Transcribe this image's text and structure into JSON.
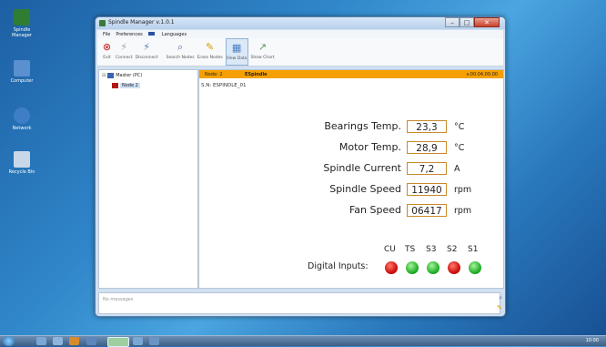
{
  "window": {
    "title": "Spindle Manager v.1.0.1"
  },
  "menu": [
    "File",
    "Preferences",
    "Languages"
  ],
  "toolbar": [
    {
      "label": "Exit",
      "icon": "close-circle-icon"
    },
    {
      "label": "Connect",
      "icon": "connect-icon"
    },
    {
      "label": "Disconnect",
      "icon": "disconnect-icon"
    },
    {
      "label": "Search Nodes",
      "icon": "magnifier-icon"
    },
    {
      "label": "Erase Nodes",
      "icon": "broom-icon"
    },
    {
      "label": "View Data",
      "icon": "table-icon"
    },
    {
      "label": "Show Chart",
      "icon": "chart-icon"
    }
  ],
  "tree": {
    "root": "Master (PC)",
    "child": "Node 2"
  },
  "header": {
    "node": "Node: 2",
    "device": "ESpindle",
    "version": "v.00.04.00.00"
  },
  "serial": "S.N: ESPINDLE_01",
  "readings": [
    {
      "label": "Bearings Temp.",
      "value": "23,3",
      "unit": "°C"
    },
    {
      "label": "Motor Temp.",
      "value": "28,9",
      "unit": "°C"
    },
    {
      "label": "Spindle Current",
      "value": "7,2",
      "unit": "A"
    },
    {
      "label": "Spindle Speed",
      "value": "11940",
      "unit": "rpm"
    },
    {
      "label": "Fan Speed",
      "value": "06417",
      "unit": "rpm"
    }
  ],
  "digital_inputs": {
    "label": "Digital Inputs:",
    "items": [
      {
        "name": "CU",
        "state": "red"
      },
      {
        "name": "TS",
        "state": "green"
      },
      {
        "name": "S3",
        "state": "green"
      },
      {
        "name": "S2",
        "state": "red"
      },
      {
        "name": "S1",
        "state": "green"
      }
    ]
  },
  "messages": {
    "placeholder": "No messages"
  },
  "desktop": {
    "icons": [
      "Spindle Manager",
      "Computer",
      "Network",
      "Recycle Bin"
    ]
  },
  "taskbar": {
    "clock": "10:00"
  }
}
